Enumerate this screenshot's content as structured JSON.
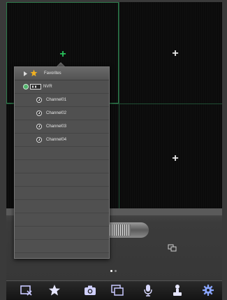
{
  "grid": {
    "cells": [
      {
        "id": "ch1",
        "add_glyph": "+",
        "active": true
      },
      {
        "id": "ch2",
        "add_glyph": "+",
        "active": false
      },
      {
        "id": "ch3",
        "add_glyph": "",
        "active": false
      },
      {
        "id": "ch4",
        "add_glyph": "+",
        "active": false
      }
    ]
  },
  "popover": {
    "favorites_label": "Favorites",
    "device": {
      "name": "NVR"
    },
    "channels": [
      "Channel01",
      "Channel02",
      "Channel03",
      "Channel04"
    ]
  },
  "pager": {
    "pages": 2,
    "current": 1
  },
  "toolbar": {
    "icons": [
      "close-all-icon",
      "favorites-star-icon",
      "snapshot-camera-icon",
      "layout-icon",
      "microphone-icon",
      "ptz-icon",
      "settings-gear-icon"
    ]
  },
  "colors": {
    "accent_green": "#27c25a",
    "star": "#f0b020",
    "gear": "#8aa6ff"
  }
}
